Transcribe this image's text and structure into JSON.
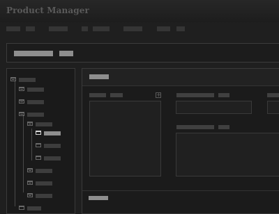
{
  "app": {
    "title": "Product Manager"
  },
  "colors": {
    "background": "#1f1f1f",
    "panel_border": "#3a3a3a",
    "placeholder_text": "#8e8e8e",
    "muted_text": "#404040"
  },
  "menu": {
    "items": [
      {
        "name": "menu-item-1"
      },
      {
        "name": "menu-item-2"
      },
      {
        "name": "menu-item-3"
      },
      {
        "name": "menu-item-4"
      },
      {
        "name": "menu-item-5"
      },
      {
        "name": "menu-item-6"
      },
      {
        "name": "menu-item-7"
      },
      {
        "name": "menu-item-8"
      }
    ]
  },
  "tree": {
    "selected_node": "tree-node-7",
    "nodes": [
      {
        "name": "tree-node-1",
        "icon": "minus-icon"
      },
      {
        "name": "tree-node-2",
        "icon": "plus-icon"
      },
      {
        "name": "tree-node-3",
        "icon": "plus-icon"
      },
      {
        "name": "tree-node-4",
        "icon": "minus-icon"
      },
      {
        "name": "tree-node-5",
        "icon": "plus-icon"
      },
      {
        "name": "tree-node-6",
        "icon": "folder-icon"
      },
      {
        "name": "tree-node-7",
        "icon": "folder-icon"
      },
      {
        "name": "tree-node-8",
        "icon": "folder-icon"
      },
      {
        "name": "tree-node-9",
        "icon": "folder-icon"
      },
      {
        "name": "tree-node-10",
        "icon": "plus-icon"
      },
      {
        "name": "tree-node-11",
        "icon": "plus-icon"
      },
      {
        "name": "tree-node-12",
        "icon": "plus-icon"
      },
      {
        "name": "tree-node-13",
        "icon": "folder-icon"
      }
    ]
  }
}
